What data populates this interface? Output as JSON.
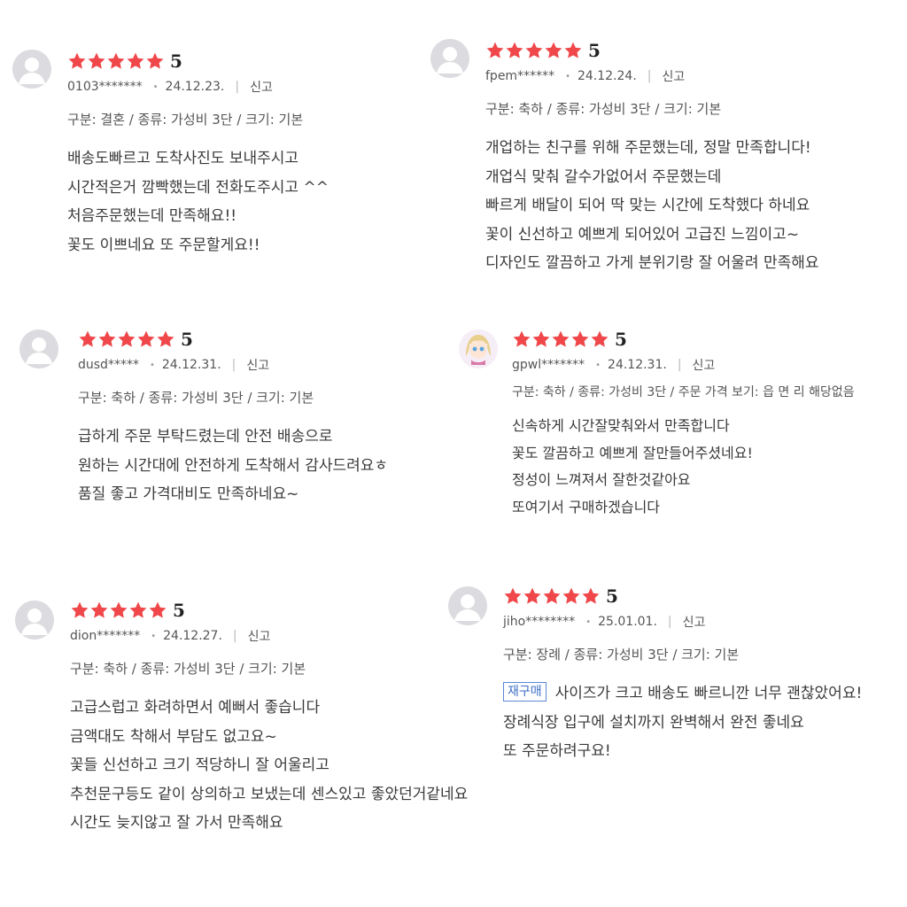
{
  "star_color": "#f0474a",
  "reviews": [
    {
      "avatar": "default-avatar",
      "score": "5",
      "user": "0103*******",
      "date": "24.12.23.",
      "report": "신고",
      "option": "구분: 결혼 / 종류: 가성비 3단 / 크기: 기본",
      "lines": [
        "배송도빠르고 도착사진도 보내주시고",
        "시간적은거 깜빡했는데 전화도주시고 ^^",
        "처음주문했는데 만족해요!!",
        "꽃도 이쁘네요 또 주문할게요!!"
      ]
    },
    {
      "avatar": "default-avatar",
      "score": "5",
      "user": "fpem******",
      "date": "24.12.24.",
      "report": "신고",
      "option": "구분: 축하 / 종류: 가성비 3단 / 크기: 기본",
      "lines": [
        "개업하는 친구를 위해 주문했는데, 정말 만족합니다!",
        "개업식 맞춰 갈수가없어서 주문했는데",
        "빠르게 배달이 되어 딱 맞는 시간에 도착했다 하네요",
        "꽃이 신선하고 예쁘게 되어있어 고급진 느낌이고~",
        "디자인도 깔끔하고 가게 분위기랑 잘 어울려 만족해요"
      ]
    },
    {
      "avatar": "default-avatar",
      "score": "5",
      "user": "dusd*****",
      "date": "24.12.31.",
      "report": "신고",
      "option": "구분: 축하 / 종류: 가성비 3단 / 크기: 기본",
      "lines": [
        "급하게 주문 부탁드렸는데 안전 배송으로",
        "원하는 시간대에 안전하게 도착해서 감사드려요ㅎ",
        "품질 좋고 가격대비도 만족하네요~"
      ]
    },
    {
      "avatar": "character-avatar",
      "score": "5",
      "user": "gpwl*******",
      "date": "24.12.31.",
      "report": "신고",
      "option": "구분: 축하 / 종류: 가성비 3단 / 주문 가격 보기: 읍 면 리 해당없음",
      "lines": [
        "신속하게 시간잘맞춰와서 만족합니다",
        "꽃도 깔끔하고 예쁘게 잘만들어주셨네요!",
        "정성이 느껴져서 잘한것같아요",
        "또여기서 구매하겠습니다"
      ]
    },
    {
      "avatar": "default-avatar",
      "score": "5",
      "user": "dion*******",
      "date": "24.12.27.",
      "report": "신고",
      "option": "구분: 축하 / 종류: 가성비 3단 / 크기: 기본",
      "lines": [
        "고급스럽고 화려하면서 예뻐서 좋습니다",
        "금액대도 착해서 부담도 없고요~",
        "꽃들 신선하고 크기 적당하니 잘 어울리고",
        "추천문구등도 같이 상의하고 보냈는데 센스있고 좋았던거같네요",
        "시간도 늦지않고 잘 가서 만족해요"
      ]
    },
    {
      "avatar": "default-avatar",
      "score": "5",
      "user": "jiho********",
      "date": "25.01.01.",
      "report": "신고",
      "option": "구분: 장례 / 종류: 가성비 3단 / 크기: 기본",
      "badge": "재구매",
      "lines": [
        "사이즈가 크고 배송도 빠르니깐 너무 괜찮았어요!",
        "장례식장 입구에 설치까지 완벽해서 완전 좋네요",
        "또 주문하려구요!"
      ]
    }
  ]
}
